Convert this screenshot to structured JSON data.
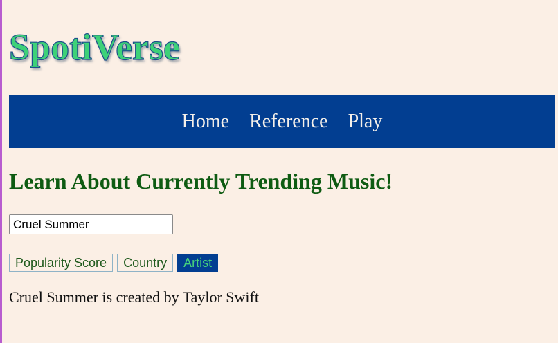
{
  "header": {
    "logo_text": "SpotiVerse"
  },
  "nav": {
    "items": [
      {
        "label": "Home"
      },
      {
        "label": "Reference"
      },
      {
        "label": "Play"
      }
    ]
  },
  "main": {
    "heading": "Learn About Currently Trending Music!",
    "search": {
      "value": "Cruel Summer",
      "placeholder": ""
    },
    "buttons": [
      {
        "label": "Popularity Score",
        "active": false
      },
      {
        "label": "Country",
        "active": false
      },
      {
        "label": "Artist",
        "active": true
      }
    ],
    "result_text": "Cruel Summer is created by Taylor Swift"
  },
  "colors": {
    "page_background": "#fbefe5",
    "nav_background": "#023e91",
    "logo_fill": "#3ed178",
    "heading": "#0e5b12",
    "active_button_text": "#46d27c"
  }
}
